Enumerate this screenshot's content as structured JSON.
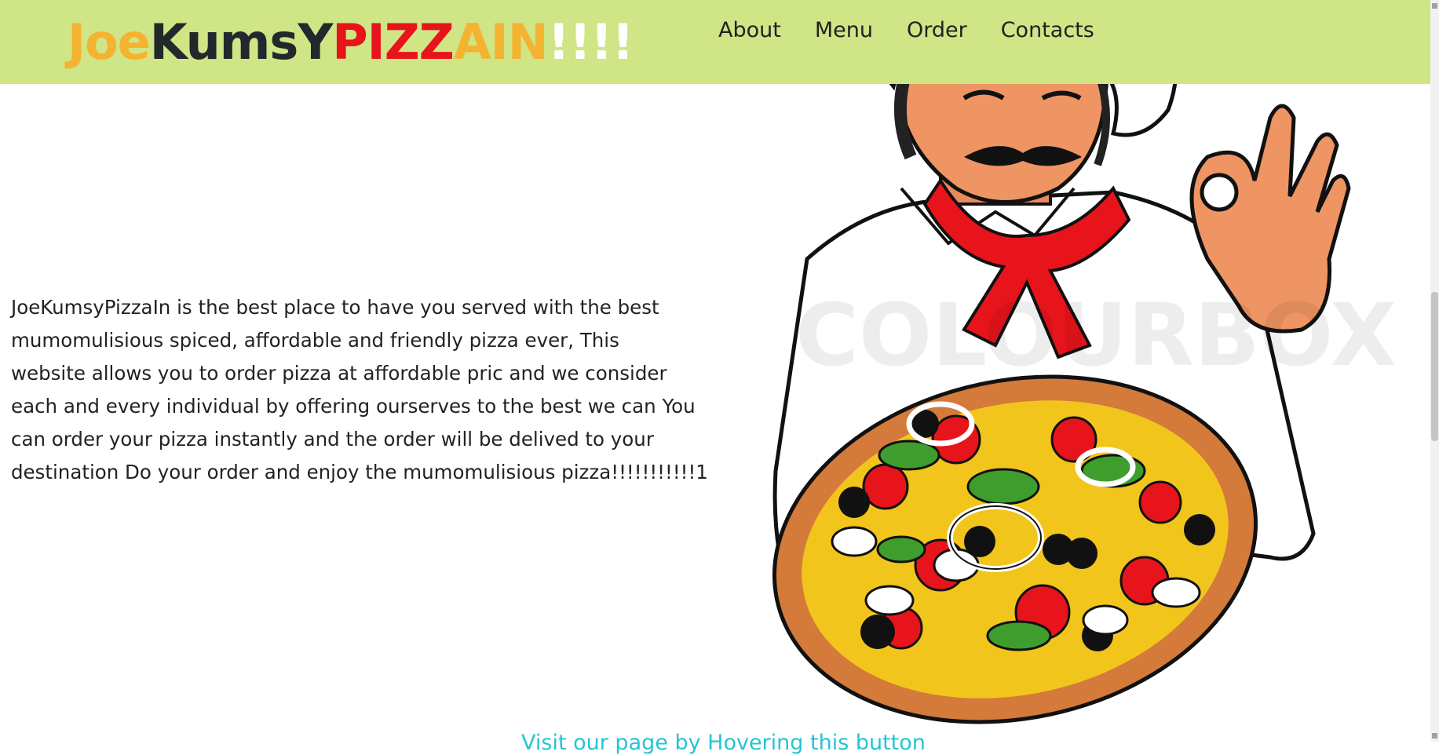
{
  "brand": {
    "parts": [
      {
        "text": "Joe",
        "color": "#f4b331"
      },
      {
        "text": "Kums",
        "color": "#22282b"
      },
      {
        "text": "Y",
        "color": "#22282b"
      },
      {
        "text": "PIZZ",
        "color": "#e8141b"
      },
      {
        "text": "AIN",
        "color": "#f4b331"
      },
      {
        "text": "!!!!",
        "color": "#ffffff"
      }
    ]
  },
  "nav": {
    "items": [
      "About",
      "Menu",
      "Order",
      "Contacts"
    ]
  },
  "hero": {
    "lines": [
      "JoeKumsyPizzaIn is the best place to have you served with the best",
      "mumomulisious spiced, affordable and friendly pizza ever, This",
      "website allows you to order pizza at affordable pric and we consider",
      "each and every individual by offering ourserves to the best we can You",
      "can order your pizza instantly and the order will be delived to your",
      "destination Do your order and enjoy the mumomulisious pizza!!!!!!!!!!!1"
    ]
  },
  "image": {
    "watermark": "COLOURBOX"
  },
  "footer": {
    "link_text": "Visit our page by Hovering this button"
  },
  "colors": {
    "navbar_bg": "#d0e585",
    "body_text": "#222222",
    "footer_link": "#26c4d6"
  }
}
